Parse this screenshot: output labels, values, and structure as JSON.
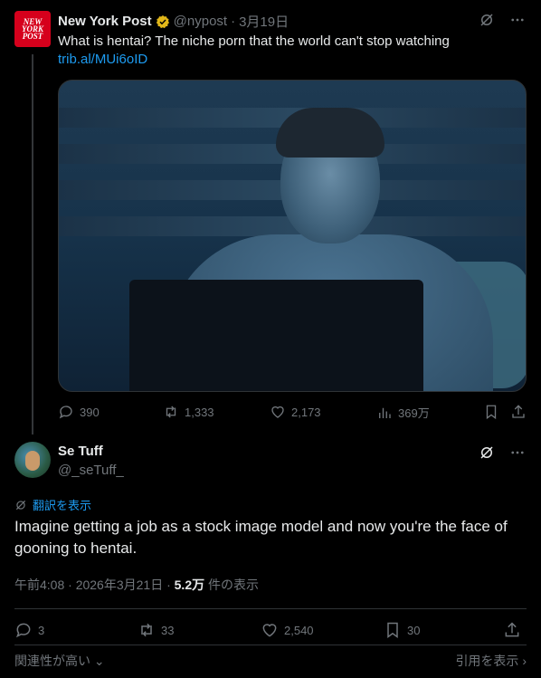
{
  "parent": {
    "avatar_text": "NEW YORK POST",
    "name": "New York Post",
    "handle": "@nypost",
    "separator": "·",
    "date": "3月19日",
    "text": "What is hentai? The niche porn that the world can't stop watching ",
    "link": "trib.al/MUi6oID",
    "actions": {
      "replies": "390",
      "reposts": "1,333",
      "likes": "2,173",
      "views": "369万"
    }
  },
  "reply": {
    "name": "Se Tuff",
    "handle": "@_seTuff_",
    "translate_label": "翻訳を表示",
    "text": "Imagine getting a job as a stock image model and now you're the face of gooning to hentai.",
    "time": "午前4:08 · 2026年3月21日 · ",
    "views_count": "5.2万",
    "views_label": " 件の表示",
    "actions": {
      "replies": "3",
      "reposts": "33",
      "likes": "2,540",
      "bookmarks": "30"
    }
  },
  "footer": {
    "sort_label": "関連性が高い",
    "quotes_label": "引用を表示"
  },
  "colors": {
    "accent": "#1d9bf0",
    "brand_red": "#d6001c",
    "verified_gold": "#e2b719",
    "muted": "#71767b",
    "background": "#000000"
  }
}
